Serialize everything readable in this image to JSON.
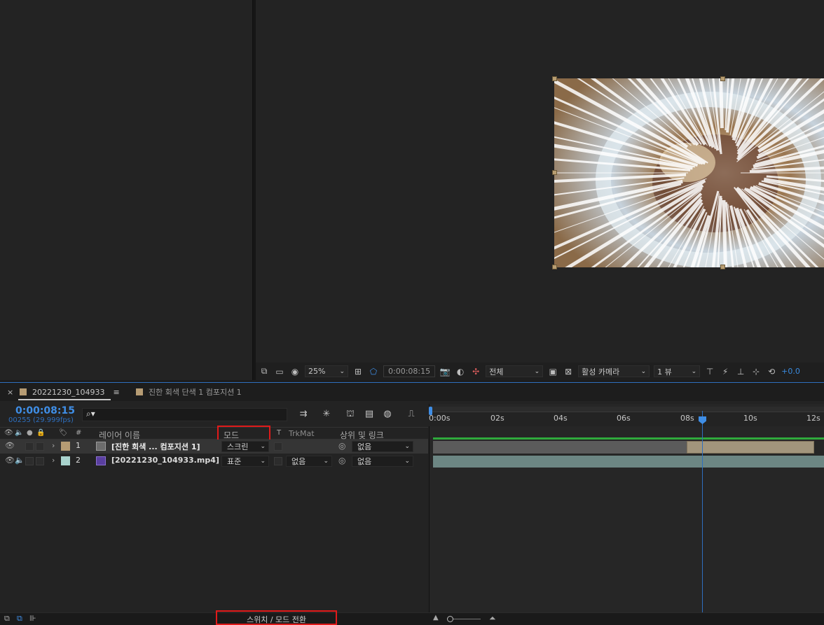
{
  "viewer": {
    "zoom": "25%",
    "timecode": "0:00:08:15",
    "resolution": "전체",
    "camera": "활성 카메라",
    "views": "1 뷰",
    "exposure": "+0.0"
  },
  "tabs": [
    {
      "label": "20221230_104933",
      "color": "#b69c74",
      "active": true
    },
    {
      "label": "진한 회색 단색 1 컴포지션 1",
      "color": "#b69c74",
      "active": false
    }
  ],
  "timeline": {
    "current_time": "0:00:08:15",
    "frames": "00255 (29.999fps)",
    "search_placeholder": "",
    "columns": {
      "number": "#",
      "name": "레이어 이름",
      "mode": "모드",
      "t": "T",
      "trkmat": "TrkMat",
      "parent": "상위 및 링크"
    },
    "layers": [
      {
        "num": "1",
        "name": "[진한 회색 ... 컴포지션 1]",
        "mode": "스크린",
        "trkmat": "",
        "parent": "없음",
        "label_color": "#b69c74",
        "selected": true
      },
      {
        "num": "2",
        "name": "[20221230_104933.mp4]",
        "mode": "표준",
        "trkmat": "없음",
        "parent": "없음",
        "label_color": "#a9d3cd",
        "selected": false
      }
    ],
    "ruler": [
      "0:00s",
      "02s",
      "04s",
      "06s",
      "08s",
      "10s",
      "12s"
    ],
    "toggle_label": "스위치 / 모드 전환"
  }
}
